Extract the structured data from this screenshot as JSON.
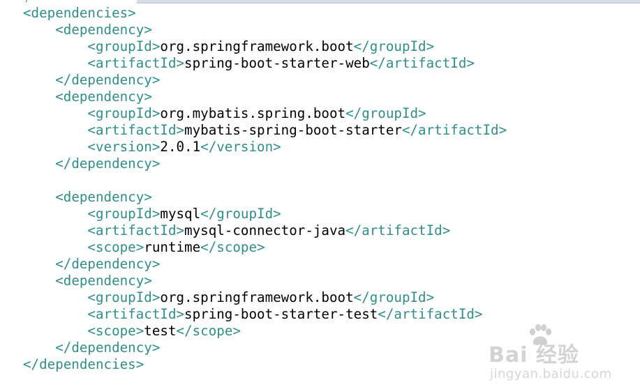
{
  "editor": {
    "lines": [
      {
        "indent": "",
        "parts": [
          [
            "tag",
            "<dependencies>"
          ]
        ]
      },
      {
        "indent": "    ",
        "parts": [
          [
            "tag",
            "<dependency>"
          ]
        ]
      },
      {
        "indent": "        ",
        "parts": [
          [
            "tag",
            "<groupId>"
          ],
          [
            "text",
            "org.springframework.boot"
          ],
          [
            "tag",
            "</groupId>"
          ]
        ]
      },
      {
        "indent": "        ",
        "parts": [
          [
            "tag",
            "<artifactId>"
          ],
          [
            "text",
            "spring-boot-starter-web"
          ],
          [
            "tag",
            "</artifactId>"
          ]
        ]
      },
      {
        "indent": "    ",
        "parts": [
          [
            "tag",
            "</dependency>"
          ]
        ]
      },
      {
        "indent": "    ",
        "parts": [
          [
            "tag",
            "<dependency>"
          ]
        ]
      },
      {
        "indent": "        ",
        "parts": [
          [
            "tag",
            "<groupId>"
          ],
          [
            "text",
            "org.mybatis.spring.boot"
          ],
          [
            "tag",
            "</groupId>"
          ]
        ]
      },
      {
        "indent": "        ",
        "parts": [
          [
            "tag",
            "<artifactId>"
          ],
          [
            "text",
            "mybatis-spring-boot-starter"
          ],
          [
            "tag",
            "</artifactId>"
          ]
        ]
      },
      {
        "indent": "        ",
        "parts": [
          [
            "tag",
            "<version>"
          ],
          [
            "text",
            "2.0.1"
          ],
          [
            "tag",
            "</version>"
          ]
        ]
      },
      {
        "indent": "    ",
        "parts": [
          [
            "tag",
            "</dependency>"
          ]
        ]
      },
      {
        "indent": "",
        "parts": []
      },
      {
        "indent": "    ",
        "parts": [
          [
            "tag",
            "<dependency>"
          ]
        ]
      },
      {
        "indent": "        ",
        "parts": [
          [
            "tag",
            "<groupId>"
          ],
          [
            "text",
            "mysql"
          ],
          [
            "tag",
            "</groupId>"
          ]
        ]
      },
      {
        "indent": "        ",
        "parts": [
          [
            "tag",
            "<artifactId>"
          ],
          [
            "text",
            "mysql-connector-java"
          ],
          [
            "tag",
            "</artifactId>"
          ]
        ]
      },
      {
        "indent": "        ",
        "parts": [
          [
            "tag",
            "<scope>"
          ],
          [
            "text",
            "runtime"
          ],
          [
            "tag",
            "</scope>"
          ]
        ]
      },
      {
        "indent": "    ",
        "parts": [
          [
            "tag",
            "</dependency>"
          ]
        ]
      },
      {
        "indent": "    ",
        "parts": [
          [
            "tag",
            "<dependency>"
          ]
        ]
      },
      {
        "indent": "        ",
        "parts": [
          [
            "tag",
            "<groupId>"
          ],
          [
            "text",
            "org.springframework.boot"
          ],
          [
            "tag",
            "</groupId>"
          ]
        ]
      },
      {
        "indent": "        ",
        "parts": [
          [
            "tag",
            "<artifactId>"
          ],
          [
            "text",
            "spring-boot-starter-test"
          ],
          [
            "tag",
            "</artifactId>"
          ]
        ]
      },
      {
        "indent": "        ",
        "parts": [
          [
            "tag",
            "<scope>"
          ],
          [
            "text",
            "test"
          ],
          [
            "tag",
            "</scope>"
          ]
        ]
      },
      {
        "indent": "    ",
        "parts": [
          [
            "tag",
            "</dependency>"
          ]
        ]
      },
      {
        "indent": "",
        "parts": [
          [
            "tag",
            "</dependencies>"
          ]
        ]
      }
    ]
  },
  "watermark": {
    "logo_text": "Bai  经验",
    "url": "jingyan.baidu.com",
    "icon": "paw-icon"
  },
  "colors": {
    "tag": "#2f8d8d",
    "text": "#000000",
    "background": "#ffffff"
  }
}
